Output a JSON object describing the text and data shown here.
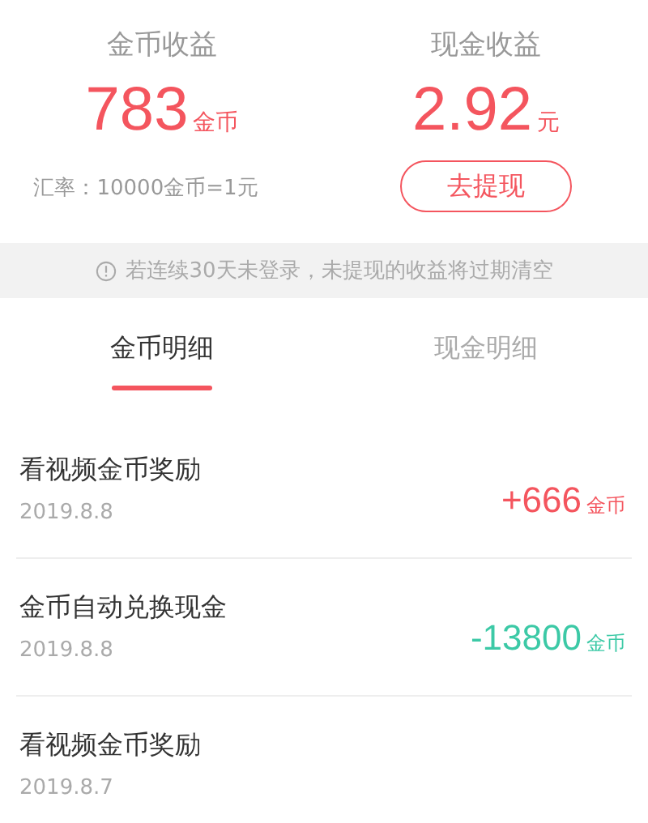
{
  "summary": [
    {
      "label": "金币收益",
      "amount": "783",
      "unit": "金币",
      "note": "汇率：10000金币=1元"
    },
    {
      "label": "现金收益",
      "amount": "2.92",
      "unit": "元",
      "button": "去提现"
    }
  ],
  "notice": "若连续30天未登录，未提现的收益将过期清空",
  "tabs": [
    {
      "label": "金币明细",
      "selected": true
    },
    {
      "label": "现金明细",
      "selected": false
    }
  ],
  "records": [
    {
      "title": "看视频金币奖励",
      "date": "2019.8.8",
      "amount": "+666",
      "unit": "金币",
      "kind": "income"
    },
    {
      "title": "金币自动兑换现金",
      "date": "2019.8.8",
      "amount": "-13800",
      "unit": "金币",
      "kind": "expense"
    },
    {
      "title": "看视频金币奖励",
      "date": "2019.8.7"
    }
  ]
}
